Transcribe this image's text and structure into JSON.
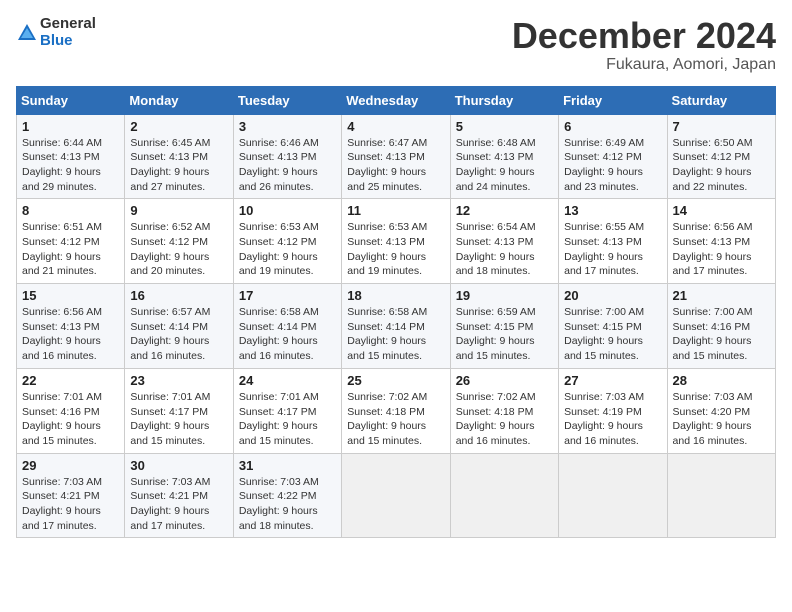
{
  "logo": {
    "general": "General",
    "blue": "Blue"
  },
  "header": {
    "month": "December 2024",
    "location": "Fukaura, Aomori, Japan"
  },
  "weekdays": [
    "Sunday",
    "Monday",
    "Tuesday",
    "Wednesday",
    "Thursday",
    "Friday",
    "Saturday"
  ],
  "weeks": [
    [
      {
        "day": 1,
        "sunrise": "6:44 AM",
        "sunset": "4:13 PM",
        "daylight": "9 hours and 29 minutes."
      },
      {
        "day": 2,
        "sunrise": "6:45 AM",
        "sunset": "4:13 PM",
        "daylight": "9 hours and 27 minutes."
      },
      {
        "day": 3,
        "sunrise": "6:46 AM",
        "sunset": "4:13 PM",
        "daylight": "9 hours and 26 minutes."
      },
      {
        "day": 4,
        "sunrise": "6:47 AM",
        "sunset": "4:13 PM",
        "daylight": "9 hours and 25 minutes."
      },
      {
        "day": 5,
        "sunrise": "6:48 AM",
        "sunset": "4:13 PM",
        "daylight": "9 hours and 24 minutes."
      },
      {
        "day": 6,
        "sunrise": "6:49 AM",
        "sunset": "4:12 PM",
        "daylight": "9 hours and 23 minutes."
      },
      {
        "day": 7,
        "sunrise": "6:50 AM",
        "sunset": "4:12 PM",
        "daylight": "9 hours and 22 minutes."
      }
    ],
    [
      {
        "day": 8,
        "sunrise": "6:51 AM",
        "sunset": "4:12 PM",
        "daylight": "9 hours and 21 minutes."
      },
      {
        "day": 9,
        "sunrise": "6:52 AM",
        "sunset": "4:12 PM",
        "daylight": "9 hours and 20 minutes."
      },
      {
        "day": 10,
        "sunrise": "6:53 AM",
        "sunset": "4:12 PM",
        "daylight": "9 hours and 19 minutes."
      },
      {
        "day": 11,
        "sunrise": "6:53 AM",
        "sunset": "4:13 PM",
        "daylight": "9 hours and 19 minutes."
      },
      {
        "day": 12,
        "sunrise": "6:54 AM",
        "sunset": "4:13 PM",
        "daylight": "9 hours and 18 minutes."
      },
      {
        "day": 13,
        "sunrise": "6:55 AM",
        "sunset": "4:13 PM",
        "daylight": "9 hours and 17 minutes."
      },
      {
        "day": 14,
        "sunrise": "6:56 AM",
        "sunset": "4:13 PM",
        "daylight": "9 hours and 17 minutes."
      }
    ],
    [
      {
        "day": 15,
        "sunrise": "6:56 AM",
        "sunset": "4:13 PM",
        "daylight": "9 hours and 16 minutes."
      },
      {
        "day": 16,
        "sunrise": "6:57 AM",
        "sunset": "4:14 PM",
        "daylight": "9 hours and 16 minutes."
      },
      {
        "day": 17,
        "sunrise": "6:58 AM",
        "sunset": "4:14 PM",
        "daylight": "9 hours and 16 minutes."
      },
      {
        "day": 18,
        "sunrise": "6:58 AM",
        "sunset": "4:14 PM",
        "daylight": "9 hours and 15 minutes."
      },
      {
        "day": 19,
        "sunrise": "6:59 AM",
        "sunset": "4:15 PM",
        "daylight": "9 hours and 15 minutes."
      },
      {
        "day": 20,
        "sunrise": "7:00 AM",
        "sunset": "4:15 PM",
        "daylight": "9 hours and 15 minutes."
      },
      {
        "day": 21,
        "sunrise": "7:00 AM",
        "sunset": "4:16 PM",
        "daylight": "9 hours and 15 minutes."
      }
    ],
    [
      {
        "day": 22,
        "sunrise": "7:01 AM",
        "sunset": "4:16 PM",
        "daylight": "9 hours and 15 minutes."
      },
      {
        "day": 23,
        "sunrise": "7:01 AM",
        "sunset": "4:17 PM",
        "daylight": "9 hours and 15 minutes."
      },
      {
        "day": 24,
        "sunrise": "7:01 AM",
        "sunset": "4:17 PM",
        "daylight": "9 hours and 15 minutes."
      },
      {
        "day": 25,
        "sunrise": "7:02 AM",
        "sunset": "4:18 PM",
        "daylight": "9 hours and 15 minutes."
      },
      {
        "day": 26,
        "sunrise": "7:02 AM",
        "sunset": "4:18 PM",
        "daylight": "9 hours and 16 minutes."
      },
      {
        "day": 27,
        "sunrise": "7:03 AM",
        "sunset": "4:19 PM",
        "daylight": "9 hours and 16 minutes."
      },
      {
        "day": 28,
        "sunrise": "7:03 AM",
        "sunset": "4:20 PM",
        "daylight": "9 hours and 16 minutes."
      }
    ],
    [
      {
        "day": 29,
        "sunrise": "7:03 AM",
        "sunset": "4:21 PM",
        "daylight": "9 hours and 17 minutes."
      },
      {
        "day": 30,
        "sunrise": "7:03 AM",
        "sunset": "4:21 PM",
        "daylight": "9 hours and 17 minutes."
      },
      {
        "day": 31,
        "sunrise": "7:03 AM",
        "sunset": "4:22 PM",
        "daylight": "9 hours and 18 minutes."
      },
      null,
      null,
      null,
      null
    ]
  ]
}
